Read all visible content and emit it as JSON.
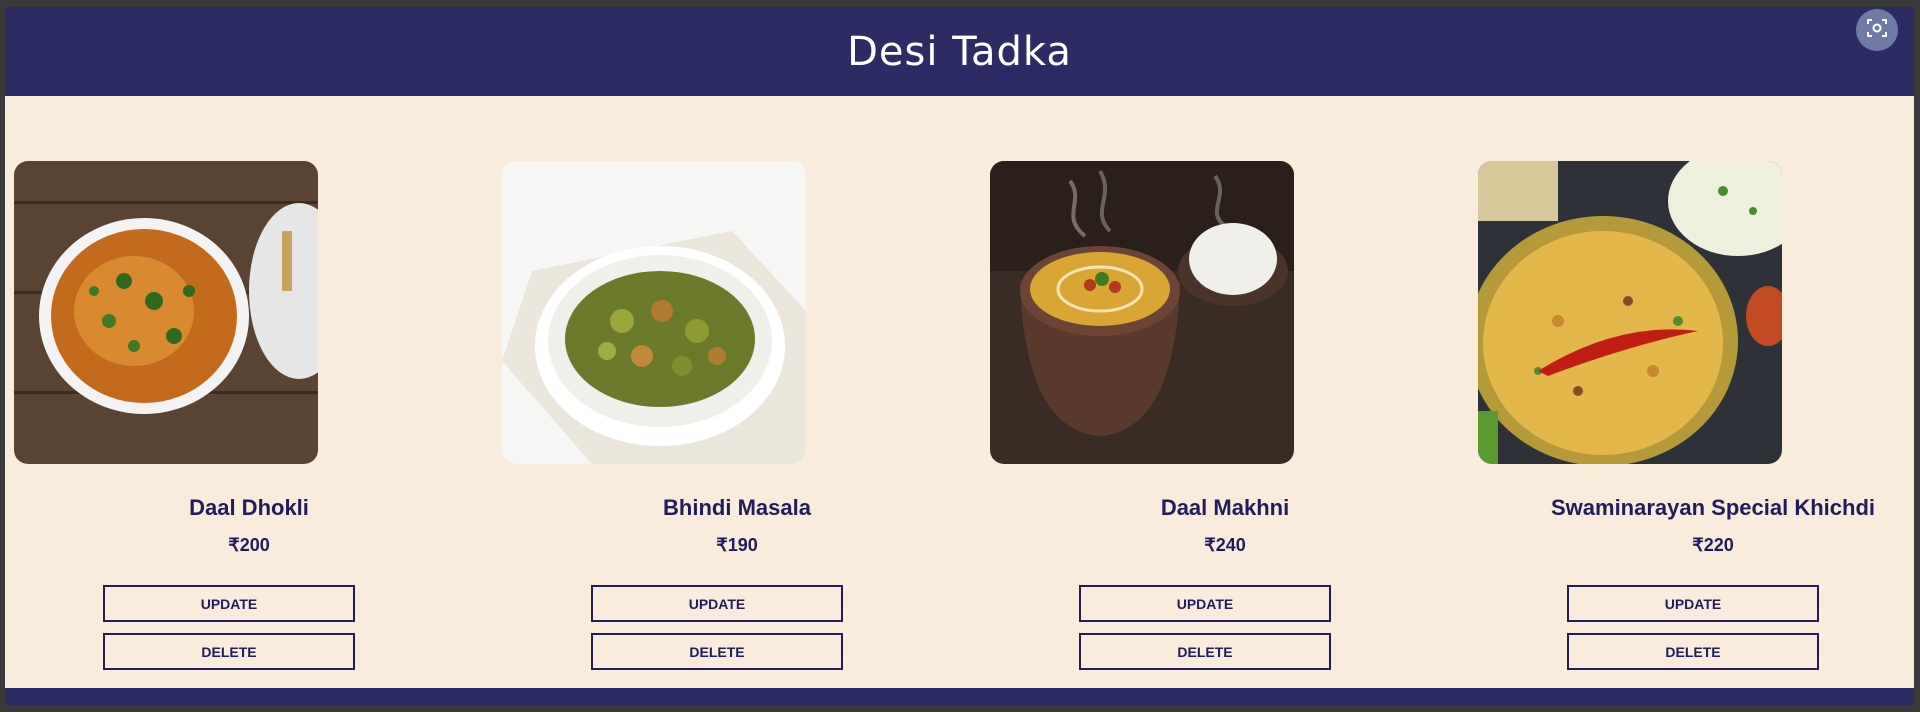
{
  "header": {
    "title": "Desi Tadka"
  },
  "currency_symbol": "₹",
  "colors": {
    "header_bg": "#2d2b63",
    "page_bg": "#faecdc",
    "text": "#1f1d5c"
  },
  "items": [
    {
      "name": "Daal Dhokli",
      "price": "₹200",
      "update_label": "UPDATE",
      "delete_label": "DELETE"
    },
    {
      "name": "Bhindi Masala",
      "price": "₹190",
      "update_label": "UPDATE",
      "delete_label": "DELETE"
    },
    {
      "name": "Daal Makhni",
      "price": "₹240",
      "update_label": "UPDATE",
      "delete_label": "DELETE"
    },
    {
      "name": "Swaminarayan Special Khichdi",
      "price": "₹220",
      "update_label": "UPDATE",
      "delete_label": "DELETE"
    }
  ]
}
